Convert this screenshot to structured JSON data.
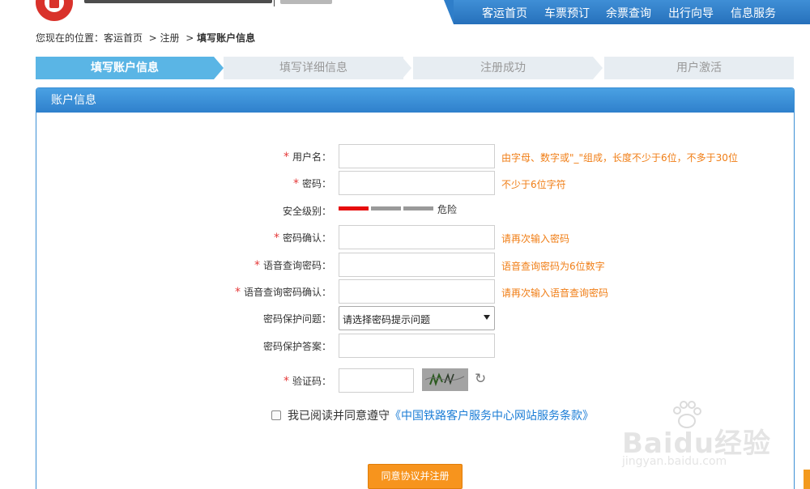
{
  "nav": {
    "items": [
      "客运首页",
      "车票预订",
      "余票查询",
      "出行向导",
      "信息服务"
    ]
  },
  "breadcrumb": {
    "prefix": "您现在的位置：",
    "items": [
      "客运首页",
      "注册",
      "填写账户信息"
    ]
  },
  "steps": [
    {
      "label": "填写账户信息",
      "active": true
    },
    {
      "label": "填写详细信息",
      "active": false
    },
    {
      "label": "注册成功",
      "active": false
    },
    {
      "label": "用户激活",
      "active": false
    }
  ],
  "panel": {
    "title": "账户信息"
  },
  "form": {
    "username": {
      "label": "用户名：",
      "required": true,
      "value": "",
      "hint": "由字母、数字或\"_\"组成，长度不少于6位，不多于30位"
    },
    "password": {
      "label": "密码：",
      "required": true,
      "value": "",
      "hint": "不少于6位字符"
    },
    "security_level": {
      "label": "安全级别：",
      "level_text": "危险",
      "level": 1,
      "max_level": 3
    },
    "password_confirm": {
      "label": "密码确认：",
      "required": true,
      "value": "",
      "hint": "请再次输入密码"
    },
    "voice_password": {
      "label": "语音查询密码：",
      "required": true,
      "value": "",
      "hint": "语音查询密码为6位数字"
    },
    "voice_password_confirm": {
      "label": "语音查询密码确认：",
      "required": true,
      "value": "",
      "hint": "请再次输入语音查询密码"
    },
    "security_question": {
      "label": "密码保护问题：",
      "selected": "请选择密码提示问题"
    },
    "security_answer": {
      "label": "密码保护答案：",
      "value": ""
    },
    "captcha": {
      "label": "验证码：",
      "required": true,
      "value": ""
    },
    "agreement": {
      "text": "我已阅读并同意遵守",
      "link": "《中国铁路客户服务中心网站服务条款》",
      "checked": false
    },
    "submit_label": "同意协议并注册"
  },
  "watermark": {
    "text": "Baidu经验",
    "url": "jingyan.baidu.com"
  },
  "colors": {
    "accent_blue": "#2f80cc",
    "step_active": "#5ab5e5",
    "hint_orange": "#f07e16",
    "required_red": "#e53a3a",
    "submit_orange": "#f7941d"
  }
}
